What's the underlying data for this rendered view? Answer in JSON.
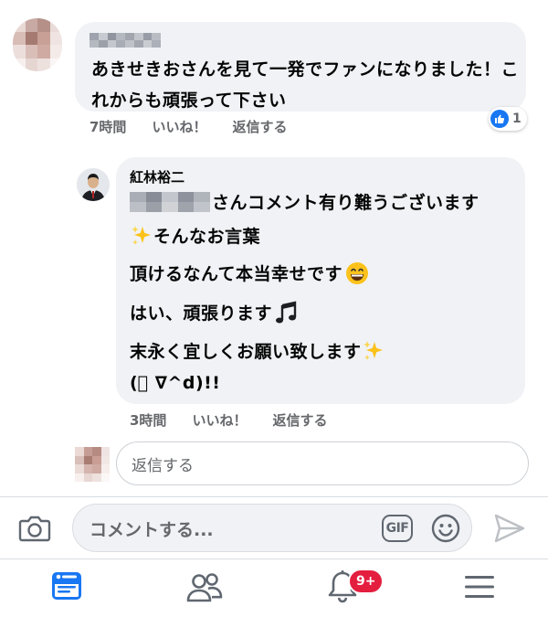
{
  "comment": {
    "text": "あきせきおさんを見て一発でファンになりました！これからも頑張って下さい",
    "time": "7時間",
    "like_label": "いいね！",
    "reply_label": "返信する",
    "reaction_count": "1"
  },
  "reply": {
    "author": "紅林裕二",
    "line1_suffix": "さんコメント有り難うございます",
    "line2": "そんなお言葉",
    "line3": "頂けるなんて本当幸せです",
    "line4": "はい、頑張ります",
    "line5": "末永く宜しくお願い致します",
    "line6": "(ﾟ ∇^d)!!",
    "time": "3時間",
    "like_label": "いいね！",
    "reply_label": "返信する"
  },
  "reply_input": {
    "placeholder": "返信する"
  },
  "composer": {
    "placeholder": "コメントする...",
    "gif_label": "GIF"
  },
  "nav": {
    "notification_badge": "9+"
  },
  "colors": {
    "accent": "#1877f2",
    "badge": "#e41e3f",
    "bubble": "#f0f2f5",
    "muted": "#65676b"
  },
  "icons": [
    "camera-icon",
    "gif-icon",
    "smiley-icon",
    "send-icon",
    "feed-icon",
    "friends-icon",
    "bell-icon",
    "menu-icon",
    "like-icon",
    "sparkle-icon",
    "grin-emoji-icon",
    "music-note-icon"
  ]
}
